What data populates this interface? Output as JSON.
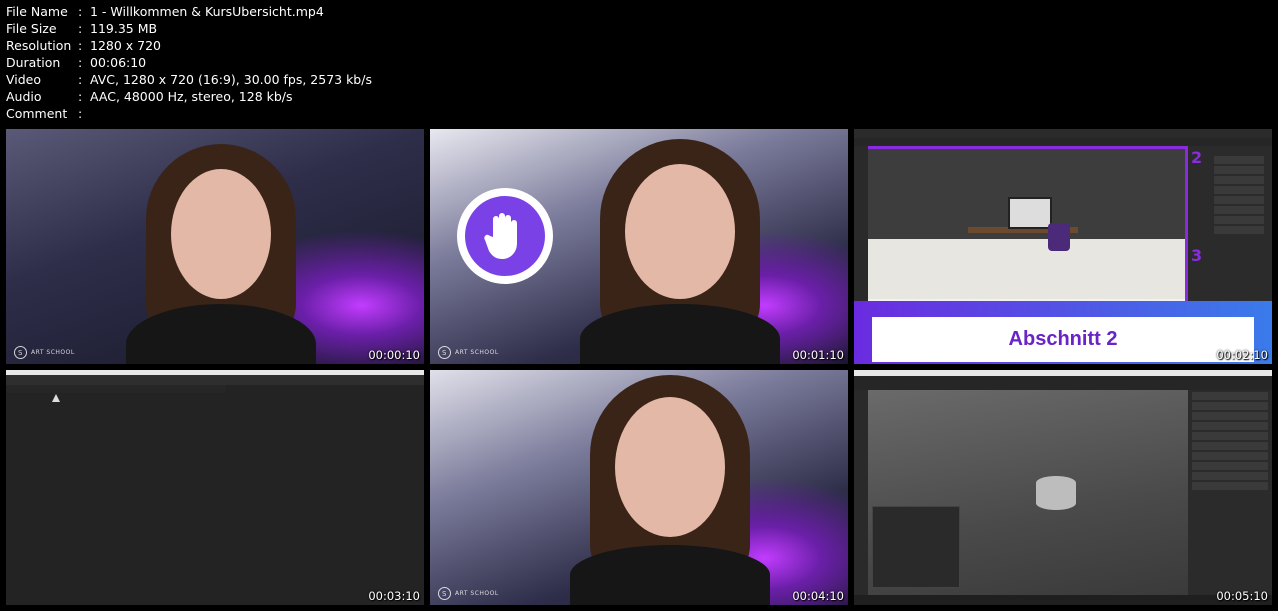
{
  "file_info": [
    {
      "label": "File Name",
      "value": "1 - Willkommen & KursUbersicht.mp4"
    },
    {
      "label": "File Size",
      "value": "119.35 MB"
    },
    {
      "label": "Resolution",
      "value": "1280 x 720"
    },
    {
      "label": "Duration",
      "value": "00:06:10"
    },
    {
      "label": "Video",
      "value": "AVC, 1280 x 720 (16:9), 30.00 fps, 2573 kb/s"
    },
    {
      "label": "Audio",
      "value": "AAC, 48000 Hz, stereo, 128 kb/s"
    },
    {
      "label": "Comment",
      "value": ""
    }
  ],
  "separator": ":",
  "watermark": {
    "text": "ART SCHOOL",
    "logo": "S"
  },
  "thumbnails": [
    {
      "timestamp": "00:00:10"
    },
    {
      "timestamp": "00:01:10"
    },
    {
      "timestamp": "00:02:10",
      "banner": "Abschnitt 2",
      "markers": [
        "2",
        "3"
      ]
    },
    {
      "timestamp": "00:03:10"
    },
    {
      "timestamp": "00:04:10"
    },
    {
      "timestamp": "00:05:10"
    }
  ],
  "colors": {
    "accent": "#8a2be2",
    "banner_text": "#6a22c9",
    "background": "#000000"
  }
}
